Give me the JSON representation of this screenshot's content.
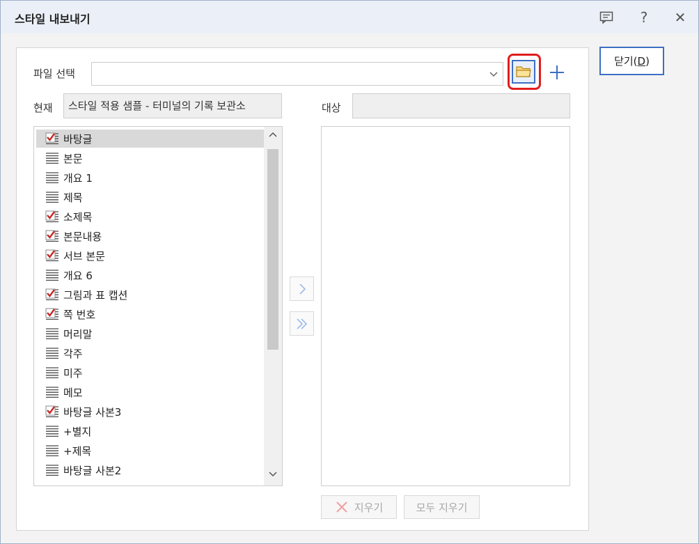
{
  "window": {
    "title": "스타일 내보내기"
  },
  "titlebar_icons": [
    "comment-icon",
    "help-icon",
    "close-icon"
  ],
  "titlebar": {
    "help_glyph": "?",
    "close_glyph": "✕"
  },
  "close_button": {
    "label": "닫기(D)",
    "prefix": "닫기(",
    "mnemonic": "D",
    "suffix": ")"
  },
  "file_select": {
    "label": "파일 선택",
    "value": ""
  },
  "current": {
    "label": "현재",
    "value": "스타일 적용 샘플 - 터미널의 기록 보관소"
  },
  "target": {
    "label": "대상",
    "value": ""
  },
  "styles": [
    {
      "name": "바탕글",
      "checked": true,
      "selected": true
    },
    {
      "name": "본문",
      "checked": false
    },
    {
      "name": "개요 1",
      "checked": false
    },
    {
      "name": "제목",
      "checked": false
    },
    {
      "name": "소제목",
      "checked": true
    },
    {
      "name": "본문내용",
      "checked": true
    },
    {
      "name": "서브 본문",
      "checked": true
    },
    {
      "name": "개요 6",
      "checked": false
    },
    {
      "name": "그림과 표 캡션",
      "checked": true
    },
    {
      "name": "쪽 번호",
      "checked": true
    },
    {
      "name": "머리말",
      "checked": false
    },
    {
      "name": "각주",
      "checked": false
    },
    {
      "name": "미주",
      "checked": false
    },
    {
      "name": "메모",
      "checked": false
    },
    {
      "name": "바탕글 사본3",
      "checked": true
    },
    {
      "name": "+별지",
      "checked": false
    },
    {
      "name": "+제목",
      "checked": false
    },
    {
      "name": "바탕글 사본2",
      "checked": false
    }
  ],
  "buttons": {
    "delete": "지우기",
    "delete_all": "모두 지우기"
  },
  "colors": {
    "accent": "#3c6fc4",
    "highlight": "#e01d1d",
    "check": "#c62828",
    "titlebar_bg": "#ebf0f8"
  }
}
